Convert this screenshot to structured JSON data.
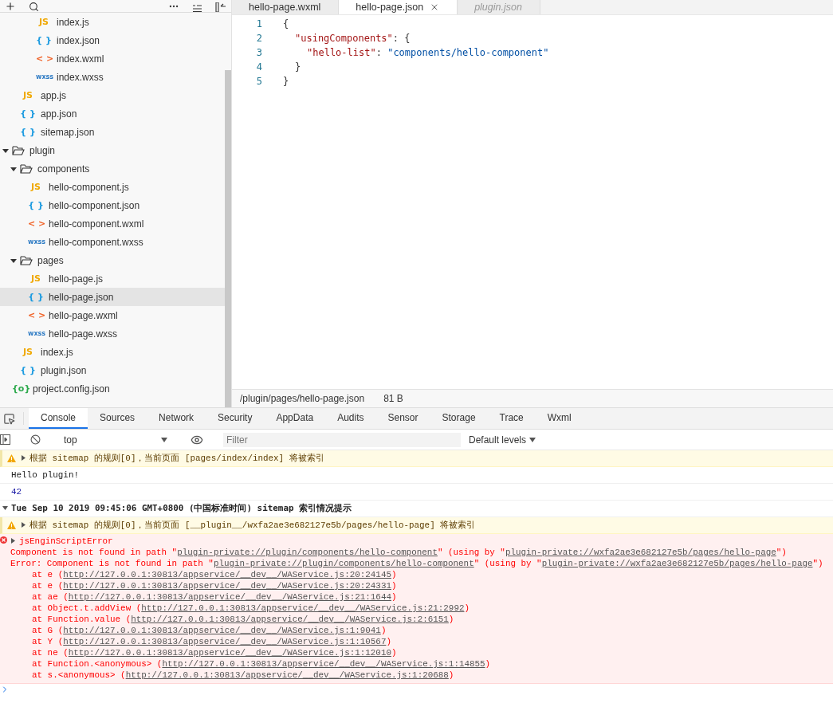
{
  "explorer": {
    "tree": [
      {
        "children": [
          {
            "children": [
              {
                "children": [
                  {
                    "name": "index.js",
                    "kind": "js",
                    "icon": "JS",
                    "selected": false
                  },
                  {
                    "name": "index.json",
                    "kind": "json",
                    "icon": "{ }",
                    "selected": false
                  },
                  {
                    "name": "index.wxml",
                    "kind": "wxml",
                    "icon": "< >",
                    "selected": false
                  },
                  {
                    "name": "index.wxss",
                    "kind": "wxss",
                    "icon": "wxss",
                    "selected": false
                  }
                ]
              }
            ]
          },
          {
            "name": "app.js",
            "kind": "js",
            "icon": "JS",
            "selected": false
          },
          {
            "name": "app.json",
            "kind": "json",
            "icon": "{ }",
            "selected": false
          },
          {
            "name": "sitemap.json",
            "kind": "json",
            "icon": "{ }",
            "selected": false
          }
        ]
      },
      {
        "name": "plugin",
        "kind": "folder",
        "expanded": true,
        "selected": false,
        "children": [
          {
            "name": "components",
            "kind": "folder",
            "expanded": true,
            "selected": false,
            "children": [
              {
                "name": "hello-component.js",
                "kind": "js",
                "icon": "JS",
                "selected": false
              },
              {
                "name": "hello-component.json",
                "kind": "json",
                "icon": "{ }",
                "selected": false
              },
              {
                "name": "hello-component.wxml",
                "kind": "wxml",
                "icon": "< >",
                "selected": false
              },
              {
                "name": "hello-component.wxss",
                "kind": "wxss",
                "icon": "wxss",
                "selected": false
              }
            ]
          },
          {
            "name": "pages",
            "kind": "folder",
            "expanded": true,
            "selected": false,
            "children": [
              {
                "name": "hello-page.js",
                "kind": "js",
                "icon": "JS",
                "selected": false
              },
              {
                "name": "hello-page.json",
                "kind": "json",
                "icon": "{ }",
                "selected": true
              },
              {
                "name": "hello-page.wxml",
                "kind": "wxml",
                "icon": "< >",
                "selected": false
              },
              {
                "name": "hello-page.wxss",
                "kind": "wxss",
                "icon": "wxss",
                "selected": false
              }
            ]
          },
          {
            "name": "index.js",
            "kind": "js",
            "icon": "JS",
            "selected": false
          },
          {
            "name": "plugin.json",
            "kind": "json",
            "icon": "{ }",
            "selected": false
          }
        ]
      },
      {
        "name": "project.config.json",
        "kind": "config",
        "icon": "{o}",
        "selected": false
      }
    ]
  },
  "editor": {
    "tabs": [
      {
        "label": "hello-page.wxml",
        "selected": false,
        "preview": false
      },
      {
        "label": "hello-page.json",
        "selected": true,
        "preview": false
      },
      {
        "label": "plugin.json",
        "selected": false,
        "preview": true
      }
    ],
    "lines": [
      {
        "number": "1",
        "kind": "outer",
        "tokens": [
          {
            "kind": "punct",
            "text": "{"
          }
        ]
      },
      {
        "number": "2",
        "kind": "member",
        "tokens": [
          {
            "kind": "key",
            "text": "\"usingComponents\""
          },
          {
            "kind": "punct",
            "text": ": {"
          }
        ]
      },
      {
        "number": "3",
        "kind": "inner",
        "tokens": [
          {
            "kind": "key",
            "text": "\"hello-list\""
          },
          {
            "kind": "punct",
            "text": ": "
          },
          {
            "kind": "string",
            "text": "\"components/hello-component\""
          }
        ]
      },
      {
        "number": "4",
        "kind": "member",
        "tokens": [
          {
            "kind": "punct",
            "text": "}"
          }
        ]
      },
      {
        "number": "5",
        "kind": "outer",
        "tokens": [
          {
            "kind": "punct",
            "text": "}"
          }
        ]
      }
    ],
    "status": {
      "path": "/plugin/pages/hello-page.json",
      "size": "81 B"
    }
  },
  "devtools": {
    "tabs": [
      {
        "label": "Console",
        "selected": true
      },
      {
        "label": "Sources",
        "selected": false
      },
      {
        "label": "Network",
        "selected": false
      },
      {
        "label": "Security",
        "selected": false
      },
      {
        "label": "AppData",
        "selected": false
      },
      {
        "label": "Audits",
        "selected": false
      },
      {
        "label": "Sensor",
        "selected": false
      },
      {
        "label": "Storage",
        "selected": false
      },
      {
        "label": "Trace",
        "selected": false
      },
      {
        "label": "Wxml",
        "selected": false
      }
    ],
    "context": "top",
    "filter_placeholder": "Filter",
    "levels": "Default levels",
    "messages": [
      {
        "kind": "warning",
        "text": "根据 sitemap 的规则[0]，当前页面 [pages/index/index] 将被索引"
      },
      {
        "kind": "log",
        "text": "Hello plugin!"
      },
      {
        "kind": "number",
        "text": "42"
      },
      {
        "kind": "group",
        "text": "Tue Sep 10 2019 09:45:06 GMT+0800 (中国标准时间) sitemap 索引情况提示",
        "expanded": true
      },
      {
        "kind": "warning",
        "text": "根据 sitemap 的规则[0]，当前页面 [__plugin__/wxfa2ae3e682127e5b/pages/hello-page] 将被索引"
      },
      {
        "kind": "error",
        "text": "jsEnginScriptError",
        "lines": [
          {
            "kind": "message",
            "parts": [
              {
                "text": "Component is not found in path \""
              },
              {
                "link": "plugin-private://plugin/components/hello-component"
              },
              {
                "text": "\" (using by \""
              },
              {
                "link": "plugin-private://wxfa2ae3e682127e5b/pages/hello-page"
              },
              {
                "text": "\")"
              }
            ]
          },
          {
            "kind": "message",
            "parts": [
              {
                "text": "Error: Component is not found in path \""
              },
              {
                "link": "plugin-private://plugin/components/hello-component"
              },
              {
                "text": "\" (using by \""
              },
              {
                "link": "plugin-private://wxfa2ae3e682127e5b/pages/hello-page"
              },
              {
                "text": "\")"
              }
            ]
          },
          {
            "kind": "stack",
            "parts": [
              {
                "text": "at e ("
              },
              {
                "link": "http://127.0.0.1:30813/appservice/__dev__/WAService.js:20:24145"
              },
              {
                "text": ")"
              }
            ]
          },
          {
            "kind": "stack",
            "parts": [
              {
                "text": "at e ("
              },
              {
                "link": "http://127.0.0.1:30813/appservice/__dev__/WAService.js:20:24331"
              },
              {
                "text": ")"
              }
            ]
          },
          {
            "kind": "stack",
            "parts": [
              {
                "text": "at ae ("
              },
              {
                "link": "http://127.0.0.1:30813/appservice/__dev__/WAService.js:21:1644"
              },
              {
                "text": ")"
              }
            ]
          },
          {
            "kind": "stack",
            "parts": [
              {
                "text": "at Object.t.addView ("
              },
              {
                "link": "http://127.0.0.1:30813/appservice/__dev__/WAService.js:21:2992"
              },
              {
                "text": ")"
              }
            ]
          },
          {
            "kind": "stack",
            "parts": [
              {
                "text": "at Function.value ("
              },
              {
                "link": "http://127.0.0.1:30813/appservice/__dev__/WAService.js:2:6151"
              },
              {
                "text": ")"
              }
            ]
          },
          {
            "kind": "stack",
            "parts": [
              {
                "text": "at G ("
              },
              {
                "link": "http://127.0.0.1:30813/appservice/__dev__/WAService.js:1:9041"
              },
              {
                "text": ")"
              }
            ]
          },
          {
            "kind": "stack",
            "parts": [
              {
                "text": "at Y ("
              },
              {
                "link": "http://127.0.0.1:30813/appservice/__dev__/WAService.js:1:10567"
              },
              {
                "text": ")"
              }
            ]
          },
          {
            "kind": "stack",
            "parts": [
              {
                "text": "at ne ("
              },
              {
                "link": "http://127.0.0.1:30813/appservice/__dev__/WAService.js:1:12010"
              },
              {
                "text": ")"
              }
            ]
          },
          {
            "kind": "stack",
            "parts": [
              {
                "text": "at Function.<anonymous> ("
              },
              {
                "link": "http://127.0.0.1:30813/appservice/__dev__/WAService.js:1:14855"
              },
              {
                "text": ")"
              }
            ]
          },
          {
            "kind": "stack",
            "parts": [
              {
                "text": "at s.<anonymous> ("
              },
              {
                "link": "http://127.0.0.1:30813/appservice/__dev__/WAService.js:1:20688"
              },
              {
                "text": ")"
              }
            ]
          }
        ]
      }
    ]
  }
}
